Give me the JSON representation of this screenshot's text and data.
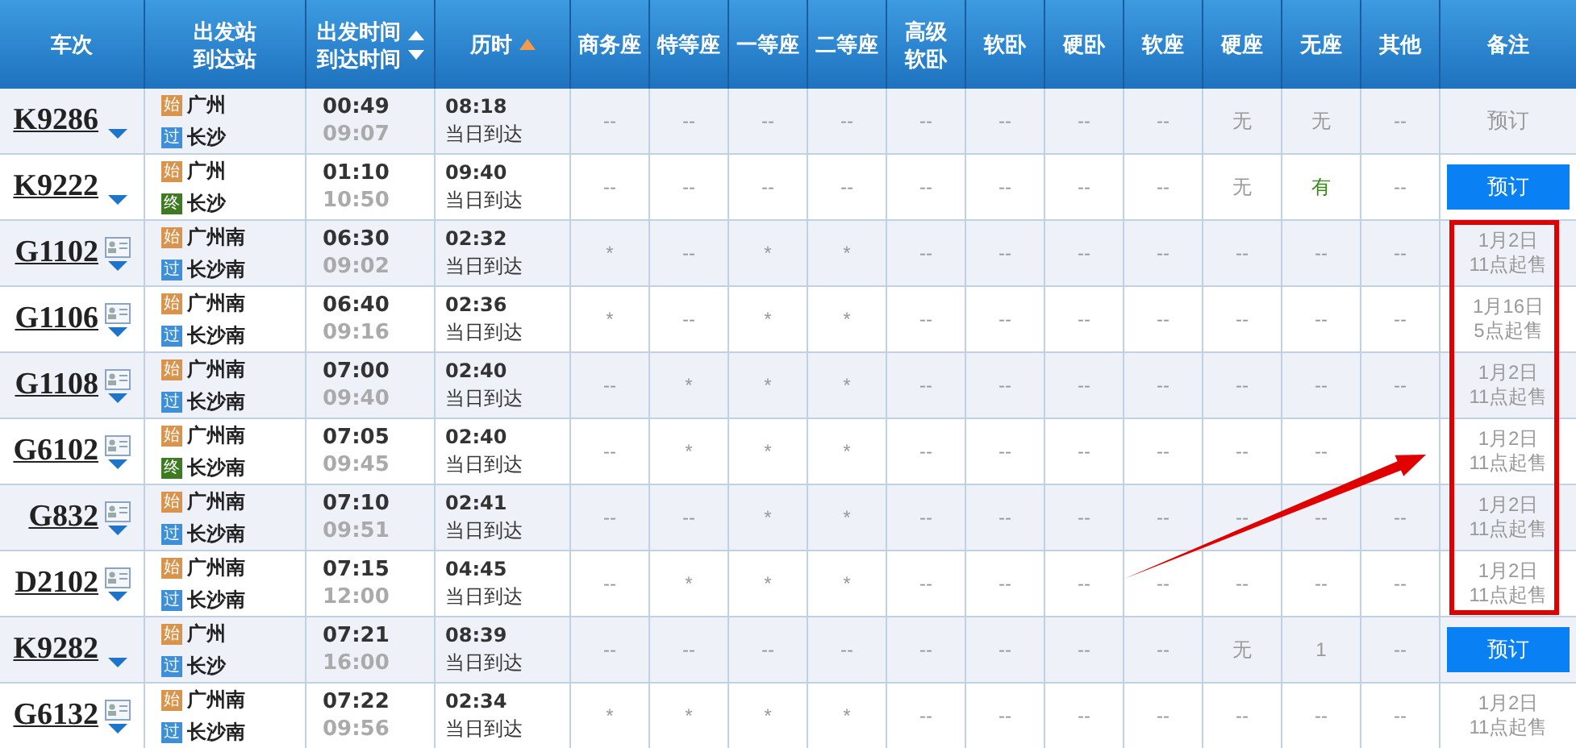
{
  "columns": [
    {
      "lines": [
        "车次"
      ]
    },
    {
      "lines": [
        "出发站",
        "到达站"
      ]
    },
    {
      "lines": [
        "出发时间",
        "到达时间"
      ],
      "sort_active": false
    },
    {
      "lines": [
        "历时"
      ],
      "sort_active": true
    },
    {
      "lines": [
        "商务座"
      ]
    },
    {
      "lines": [
        "特等座"
      ]
    },
    {
      "lines": [
        "一等座"
      ]
    },
    {
      "lines": [
        "二等座"
      ]
    },
    {
      "lines": [
        "高级",
        "软卧"
      ]
    },
    {
      "lines": [
        "软卧"
      ]
    },
    {
      "lines": [
        "硬卧"
      ]
    },
    {
      "lines": [
        "软座"
      ]
    },
    {
      "lines": [
        "硬座"
      ]
    },
    {
      "lines": [
        "无座"
      ]
    },
    {
      "lines": [
        "其他"
      ]
    },
    {
      "lines": [
        "备注"
      ]
    }
  ],
  "rows": [
    {
      "train": "K9286",
      "info_icon": false,
      "from": {
        "tag": "始",
        "kind": "start",
        "name": "广州"
      },
      "to": {
        "tag": "过",
        "kind": "pass",
        "name": "长沙"
      },
      "depart": "00:49",
      "arrive": "09:07",
      "duration": "08:18",
      "arrival_day": "当日到达",
      "seats": [
        {
          "text": "--",
          "available": false
        },
        {
          "text": "--",
          "available": false
        },
        {
          "text": "--",
          "available": false
        },
        {
          "text": "--",
          "available": false
        },
        {
          "text": "--",
          "available": false
        },
        {
          "text": "--",
          "available": false
        },
        {
          "text": "--",
          "available": false
        },
        {
          "text": "--",
          "available": false
        },
        {
          "text": "无",
          "available": false
        },
        {
          "text": "无",
          "available": false
        },
        {
          "text": "--",
          "available": false
        }
      ],
      "note": {
        "kind": "disabled",
        "lines": [
          "预订"
        ]
      }
    },
    {
      "train": "K9222",
      "info_icon": false,
      "from": {
        "tag": "始",
        "kind": "start",
        "name": "广州"
      },
      "to": {
        "tag": "终",
        "kind": "end",
        "name": "长沙"
      },
      "depart": "01:10",
      "arrive": "10:50",
      "duration": "09:40",
      "arrival_day": "当日到达",
      "seats": [
        {
          "text": "--",
          "available": false
        },
        {
          "text": "--",
          "available": false
        },
        {
          "text": "--",
          "available": false
        },
        {
          "text": "--",
          "available": false
        },
        {
          "text": "--",
          "available": false
        },
        {
          "text": "--",
          "available": false
        },
        {
          "text": "--",
          "available": false
        },
        {
          "text": "--",
          "available": false
        },
        {
          "text": "无",
          "available": false
        },
        {
          "text": "有",
          "available": true
        },
        {
          "text": "--",
          "available": false
        }
      ],
      "note": {
        "kind": "button",
        "lines": [
          "预订"
        ]
      }
    },
    {
      "train": "G1102",
      "info_icon": true,
      "from": {
        "tag": "始",
        "kind": "start",
        "name": "广州南"
      },
      "to": {
        "tag": "过",
        "kind": "pass",
        "name": "长沙南"
      },
      "depart": "06:30",
      "arrive": "09:02",
      "duration": "02:32",
      "arrival_day": "当日到达",
      "seats": [
        {
          "text": "*",
          "available": false
        },
        {
          "text": "--",
          "available": false
        },
        {
          "text": "*",
          "available": false
        },
        {
          "text": "*",
          "available": false
        },
        {
          "text": "--",
          "available": false
        },
        {
          "text": "--",
          "available": false
        },
        {
          "text": "--",
          "available": false
        },
        {
          "text": "--",
          "available": false
        },
        {
          "text": "--",
          "available": false
        },
        {
          "text": "--",
          "available": false
        },
        {
          "text": "--",
          "available": false
        }
      ],
      "note": {
        "kind": "text",
        "lines": [
          "1月2日",
          "11点起售"
        ]
      }
    },
    {
      "train": "G1106",
      "info_icon": true,
      "from": {
        "tag": "始",
        "kind": "start",
        "name": "广州南"
      },
      "to": {
        "tag": "过",
        "kind": "pass",
        "name": "长沙南"
      },
      "depart": "06:40",
      "arrive": "09:16",
      "duration": "02:36",
      "arrival_day": "当日到达",
      "seats": [
        {
          "text": "*",
          "available": false
        },
        {
          "text": "--",
          "available": false
        },
        {
          "text": "*",
          "available": false
        },
        {
          "text": "*",
          "available": false
        },
        {
          "text": "--",
          "available": false
        },
        {
          "text": "--",
          "available": false
        },
        {
          "text": "--",
          "available": false
        },
        {
          "text": "--",
          "available": false
        },
        {
          "text": "--",
          "available": false
        },
        {
          "text": "--",
          "available": false
        },
        {
          "text": "--",
          "available": false
        }
      ],
      "note": {
        "kind": "text",
        "lines": [
          "1月16日",
          "5点起售"
        ]
      }
    },
    {
      "train": "G1108",
      "info_icon": true,
      "from": {
        "tag": "始",
        "kind": "start",
        "name": "广州南"
      },
      "to": {
        "tag": "过",
        "kind": "pass",
        "name": "长沙南"
      },
      "depart": "07:00",
      "arrive": "09:40",
      "duration": "02:40",
      "arrival_day": "当日到达",
      "seats": [
        {
          "text": "--",
          "available": false
        },
        {
          "text": "*",
          "available": false
        },
        {
          "text": "*",
          "available": false
        },
        {
          "text": "*",
          "available": false
        },
        {
          "text": "--",
          "available": false
        },
        {
          "text": "--",
          "available": false
        },
        {
          "text": "--",
          "available": false
        },
        {
          "text": "--",
          "available": false
        },
        {
          "text": "--",
          "available": false
        },
        {
          "text": "--",
          "available": false
        },
        {
          "text": "--",
          "available": false
        }
      ],
      "note": {
        "kind": "text",
        "lines": [
          "1月2日",
          "11点起售"
        ]
      }
    },
    {
      "train": "G6102",
      "info_icon": true,
      "from": {
        "tag": "始",
        "kind": "start",
        "name": "广州南"
      },
      "to": {
        "tag": "终",
        "kind": "end",
        "name": "长沙南"
      },
      "depart": "07:05",
      "arrive": "09:45",
      "duration": "02:40",
      "arrival_day": "当日到达",
      "seats": [
        {
          "text": "--",
          "available": false
        },
        {
          "text": "*",
          "available": false
        },
        {
          "text": "*",
          "available": false
        },
        {
          "text": "*",
          "available": false
        },
        {
          "text": "--",
          "available": false
        },
        {
          "text": "--",
          "available": false
        },
        {
          "text": "--",
          "available": false
        },
        {
          "text": "--",
          "available": false
        },
        {
          "text": "--",
          "available": false
        },
        {
          "text": "--",
          "available": false
        }
      ],
      "note": {
        "kind": "text",
        "lines": [
          "1月2日",
          "11点起售"
        ]
      }
    },
    {
      "train": "G832",
      "info_icon": true,
      "from": {
        "tag": "始",
        "kind": "start",
        "name": "广州南"
      },
      "to": {
        "tag": "过",
        "kind": "pass",
        "name": "长沙南"
      },
      "depart": "07:10",
      "arrive": "09:51",
      "duration": "02:41",
      "arrival_day": "当日到达",
      "seats": [
        {
          "text": "--",
          "available": false
        },
        {
          "text": "--",
          "available": false
        },
        {
          "text": "*",
          "available": false
        },
        {
          "text": "*",
          "available": false
        },
        {
          "text": "--",
          "available": false
        },
        {
          "text": "--",
          "available": false
        },
        {
          "text": "--",
          "available": false
        },
        {
          "text": "--",
          "available": false
        },
        {
          "text": "--",
          "available": false
        },
        {
          "text": "--",
          "available": false
        },
        {
          "text": "--",
          "available": false
        }
      ],
      "note": {
        "kind": "text",
        "lines": [
          "1月2日",
          "11点起售"
        ]
      }
    },
    {
      "train": "D2102",
      "info_icon": true,
      "from": {
        "tag": "始",
        "kind": "start",
        "name": "广州南"
      },
      "to": {
        "tag": "过",
        "kind": "pass",
        "name": "长沙南"
      },
      "depart": "07:15",
      "arrive": "12:00",
      "duration": "04:45",
      "arrival_day": "当日到达",
      "seats": [
        {
          "text": "--",
          "available": false
        },
        {
          "text": "*",
          "available": false
        },
        {
          "text": "*",
          "available": false
        },
        {
          "text": "*",
          "available": false
        },
        {
          "text": "--",
          "available": false
        },
        {
          "text": "--",
          "available": false
        },
        {
          "text": "--",
          "available": false
        },
        {
          "text": "--",
          "available": false
        },
        {
          "text": "--",
          "available": false
        },
        {
          "text": "--",
          "available": false
        },
        {
          "text": "--",
          "available": false
        }
      ],
      "note": {
        "kind": "text",
        "lines": [
          "1月2日",
          "11点起售"
        ]
      }
    },
    {
      "train": "K9282",
      "info_icon": false,
      "from": {
        "tag": "始",
        "kind": "start",
        "name": "广州"
      },
      "to": {
        "tag": "过",
        "kind": "pass",
        "name": "长沙"
      },
      "depart": "07:21",
      "arrive": "16:00",
      "duration": "08:39",
      "arrival_day": "当日到达",
      "seats": [
        {
          "text": "--",
          "available": false
        },
        {
          "text": "--",
          "available": false
        },
        {
          "text": "--",
          "available": false
        },
        {
          "text": "--",
          "available": false
        },
        {
          "text": "--",
          "available": false
        },
        {
          "text": "--",
          "available": false
        },
        {
          "text": "--",
          "available": false
        },
        {
          "text": "--",
          "available": false
        },
        {
          "text": "无",
          "available": false
        },
        {
          "text": "1",
          "available": false
        },
        {
          "text": "--",
          "available": false
        }
      ],
      "note": {
        "kind": "button",
        "lines": [
          "预订"
        ]
      }
    },
    {
      "train": "G6132",
      "info_icon": true,
      "from": {
        "tag": "始",
        "kind": "start",
        "name": "广州南"
      },
      "to": {
        "tag": "过",
        "kind": "pass",
        "name": "长沙南"
      },
      "depart": "07:22",
      "arrive": "09:56",
      "duration": "02:34",
      "arrival_day": "当日到达",
      "seats": [
        {
          "text": "*",
          "available": false
        },
        {
          "text": "*",
          "available": false
        },
        {
          "text": "*",
          "available": false
        },
        {
          "text": "*",
          "available": false
        },
        {
          "text": "--",
          "available": false
        },
        {
          "text": "--",
          "available": false
        },
        {
          "text": "--",
          "available": false
        },
        {
          "text": "--",
          "available": false
        },
        {
          "text": "--",
          "available": false
        },
        {
          "text": "--",
          "available": false
        },
        {
          "text": "--",
          "available": false
        }
      ],
      "note": {
        "kind": "text",
        "lines": [
          "1月2日",
          "11点起售"
        ]
      }
    }
  ]
}
